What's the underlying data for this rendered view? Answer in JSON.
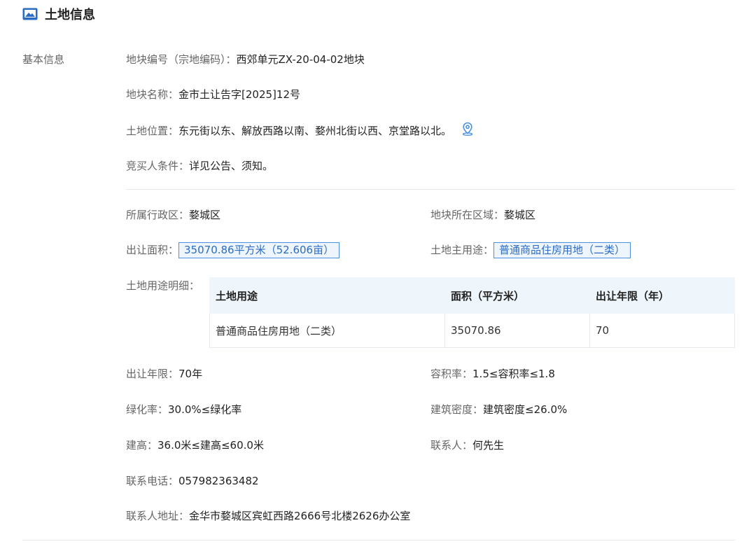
{
  "header": {
    "title": "土地信息",
    "icon": "image-icon"
  },
  "section": {
    "label": "基本信息"
  },
  "basic": {
    "parcel_code_label": "地块编号（宗地编码）：",
    "parcel_code": "西郊单元ZX-20-04-02地块",
    "parcel_name_label": "地块名称：",
    "parcel_name": "金市土让告字[2025]12号",
    "location_label": "土地位置：",
    "location": "东元街以东、解放西路以南、婺州北街以西、京堂路以北。",
    "bidder_label": "竞买人条件：",
    "bidder": "详见公告、须知。"
  },
  "details": {
    "district_label": "所属行政区：",
    "district": "婺城区",
    "region_label": "地块所在区域：",
    "region": "婺城区",
    "area_label": "出让面积：",
    "area": "35070.86平方米（52.606亩）",
    "main_use_label": "土地主用途：",
    "main_use": "普通商品住房用地（二类）",
    "use_detail_label": "土地用途明细：",
    "term_label": "出让年限：",
    "term": "70年",
    "far_label": "容积率：",
    "far": "1.5≤容积率≤1.8",
    "green_label": "绿化率：",
    "green": "30.0%≤绿化率",
    "density_label": "建筑密度：",
    "density": "建筑密度≤26.0%",
    "height_label": "建高：",
    "height": "36.0米≤建高≤60.0米",
    "contact_label": "联系人：",
    "contact": "何先生",
    "phone_label": "联系电话：",
    "phone": "057982363482",
    "address_label": "联系人地址：",
    "address": "金华市婺城区宾虹西路2666号北楼2626办公室"
  },
  "usage_table": {
    "headers": [
      "土地用途",
      "面积（平方米）",
      "出让年限（年）"
    ],
    "rows": [
      [
        "普通商品住房用地（二类）",
        "35070.86",
        "70"
      ]
    ]
  },
  "colors": {
    "accent": "#2b6cc4",
    "border": "#4a90e2",
    "table_header": "#eef5fb"
  }
}
